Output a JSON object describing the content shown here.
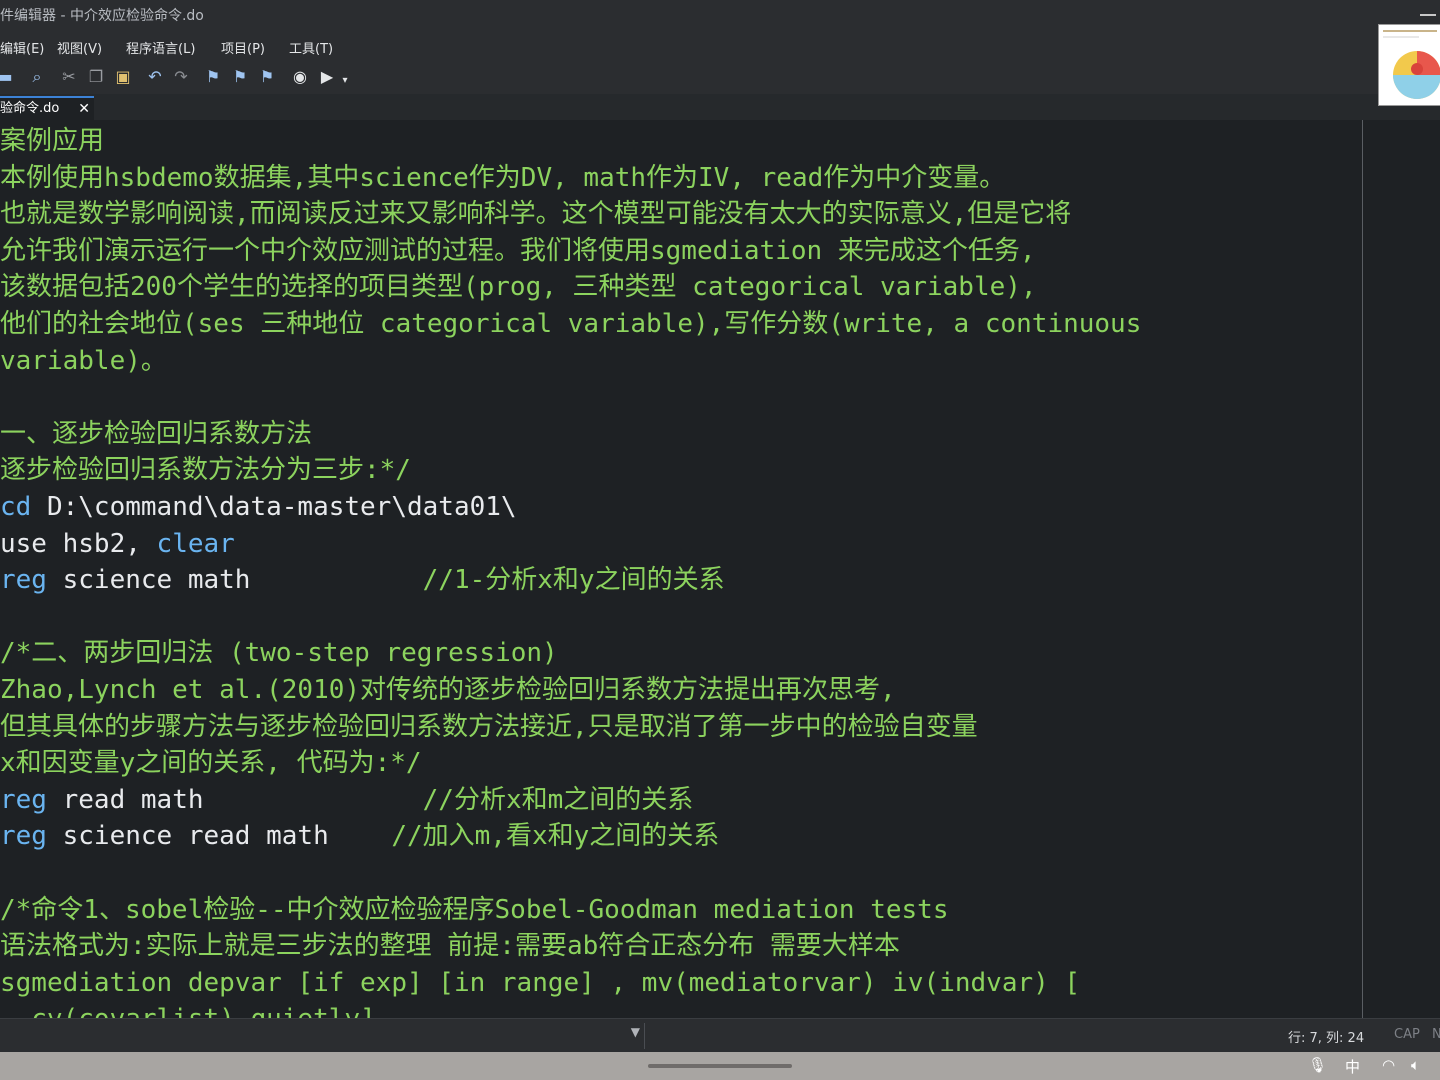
{
  "window": {
    "title": "件编辑器 - 中介效应检验命令.do"
  },
  "menu": [
    {
      "label": "编辑(E)"
    },
    {
      "label": "视图(V)"
    },
    {
      "label": "程序语言(L)"
    },
    {
      "label": "项目(P)"
    },
    {
      "label": "工具(T)"
    }
  ],
  "toolbar": {
    "icons": [
      "print-icon",
      "find-icon",
      "cut-icon",
      "copy-icon",
      "paste-icon",
      "undo-icon",
      "redo-icon",
      "bookmark-toggle-icon",
      "bookmark-prev-icon",
      "bookmark-next-icon",
      "show-icon",
      "execute-icon"
    ]
  },
  "tab": {
    "label": "验命令.do",
    "close": "✕"
  },
  "editor": {
    "lines": [
      [
        {
          "t": "案例应用",
          "c": "cm"
        }
      ],
      [
        {
          "t": "本例使用hsbdemo数据集,其中science作为DV, math作为IV, read作为中介变量。",
          "c": "cm"
        }
      ],
      [
        {
          "t": "也就是数学影响阅读,而阅读反过来又影响科学。这个模型可能没有太大的实际意义,但是它将",
          "c": "cm"
        }
      ],
      [
        {
          "t": "允许我们演示运行一个中介效应测试的过程。我们将使用sgmediation 来完成这个任务,",
          "c": "cm"
        }
      ],
      [
        {
          "t": "该数据包括200个学生的选择的项目类型(prog, 三种类型 categorical variable),",
          "c": "cm"
        }
      ],
      [
        {
          "t": "他们的社会地位(ses 三种地位 categorical variable),写作分数(write, a continuous",
          "c": "cm"
        }
      ],
      [
        {
          "t": "variable)。",
          "c": "cm"
        }
      ],
      [],
      [
        {
          "t": "一、逐步检验回归系数方法",
          "c": "cm"
        }
      ],
      [
        {
          "t": "逐步检验回归系数方法分为三步:*/",
          "c": "cm"
        }
      ],
      [
        {
          "t": "cd",
          "c": "kw"
        },
        {
          "t": " D:\\command\\data-master\\data01\\",
          "c": ""
        }
      ],
      [
        {
          "t": "use hsb2, ",
          "c": ""
        },
        {
          "t": "clear",
          "c": "kw"
        }
      ],
      [
        {
          "t": "reg",
          "c": "kw"
        },
        {
          "t": " science math           ",
          "c": ""
        },
        {
          "t": "//1-分析x和y之间的关系",
          "c": "cm"
        }
      ],
      [],
      [
        {
          "t": "/*二、两步回归法 (two-step regression)",
          "c": "cm"
        }
      ],
      [
        {
          "t": "Zhao,Lynch et al.(2010)对传统的逐步检验回归系数方法提出再次思考,",
          "c": "cm"
        }
      ],
      [
        {
          "t": "但其具体的步骤方法与逐步检验回归系数方法接近,只是取消了第一步中的检验自变量",
          "c": "cm"
        }
      ],
      [
        {
          "t": "x和因变量y之间的关系, 代码为:*/",
          "c": "cm"
        }
      ],
      [
        {
          "t": "reg",
          "c": "kw"
        },
        {
          "t": " read math              ",
          "c": ""
        },
        {
          "t": "//分析x和m之间的关系",
          "c": "cm"
        }
      ],
      [
        {
          "t": "reg",
          "c": "kw"
        },
        {
          "t": " science read math    ",
          "c": ""
        },
        {
          "t": "//加入m,看x和y之间的关系",
          "c": "cm"
        }
      ],
      [],
      [
        {
          "t": "/*命令1、sobel检验--中介效应检验程序Sobel-Goodman mediation tests",
          "c": "cm"
        }
      ],
      [
        {
          "t": "语法格式为:实际上就是三步法的整理 前提:需要ab符合正态分布 需要大样本",
          "c": "cm"
        }
      ],
      [
        {
          "t": "sgmediation depvar [if exp] [in range] , mv(mediatorvar) iv(indvar) [",
          "c": "cm"
        }
      ],
      [
        {
          "t": "  cv(covarlist) quietly]",
          "c": "cm"
        }
      ]
    ]
  },
  "status": {
    "position": "行: 7, 列: 24",
    "cap": "CAP",
    "num": "N"
  },
  "taskbar": {
    "ime": "中"
  }
}
